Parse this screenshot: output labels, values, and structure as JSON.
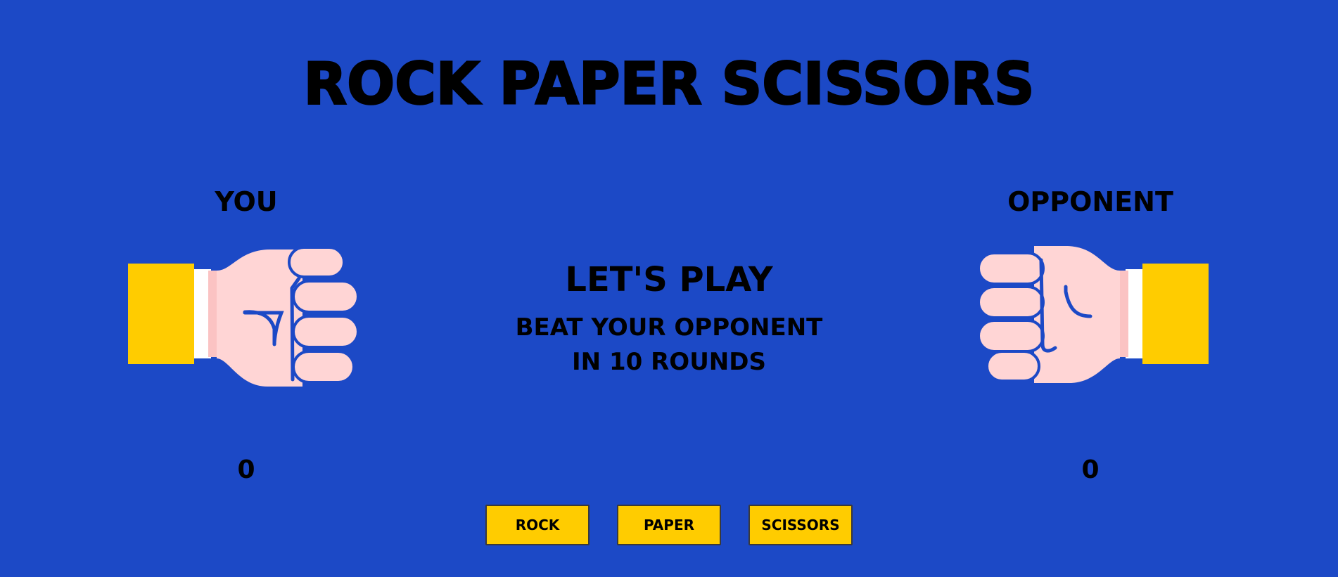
{
  "game": {
    "title": "ROCK PAPER SCISSORS"
  },
  "player": {
    "label": "YOU",
    "score": "0",
    "hand": "fist-icon"
  },
  "opponent": {
    "label": "OPPONENT",
    "score": "0",
    "hand": "fist-icon"
  },
  "status": {
    "heading": "LET'S PLAY",
    "message": "BEAT YOUR OPPONENT IN 10 ROUNDS"
  },
  "controls": {
    "rock_label": "ROCK",
    "paper_label": "PAPER",
    "scissors_label": "SCISSORS"
  },
  "colors": {
    "background": "#1c49c6",
    "sleeve": "#ffcc00",
    "skin": "#ffd5d5",
    "button": "#ffcc00"
  }
}
